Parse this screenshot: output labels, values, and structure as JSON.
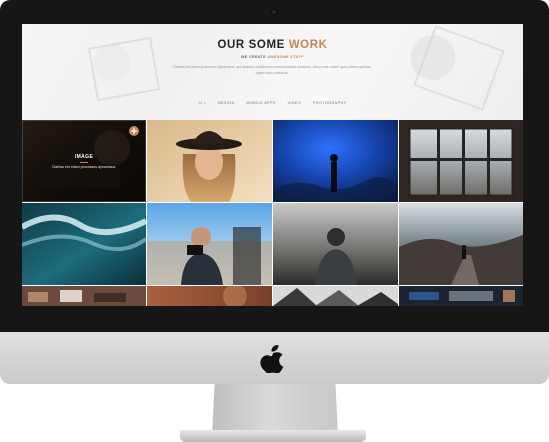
{
  "hero": {
    "title_main": "OUR SOME",
    "title_accent": "WORK",
    "subtitle_prefix": "WE CREATE",
    "subtitle_accent": "AWESOME STUFF",
    "description": "Claritas est etiam processus dynamicus, qui sequitur mutationem consuetudium lectorum. Mirum est notare quam littera gothica, quam nunc putamus."
  },
  "filters": {
    "items": [
      {
        "label": "ALL",
        "active": true
      },
      {
        "label": "DESIGN",
        "active": false
      },
      {
        "label": "MOBILE APPS",
        "active": false
      },
      {
        "label": "VIDEO",
        "active": false
      },
      {
        "label": "PHOTOGRAPHY",
        "active": false
      }
    ]
  },
  "featured_tile": {
    "title": "IMAGE",
    "description": "Claritas est etiam processus dynamicus.",
    "zoom_icon": "plus-circle-icon"
  },
  "colors": {
    "accent": "#c9845a",
    "bezel": "#161616",
    "chin": "#d4d4d4"
  }
}
